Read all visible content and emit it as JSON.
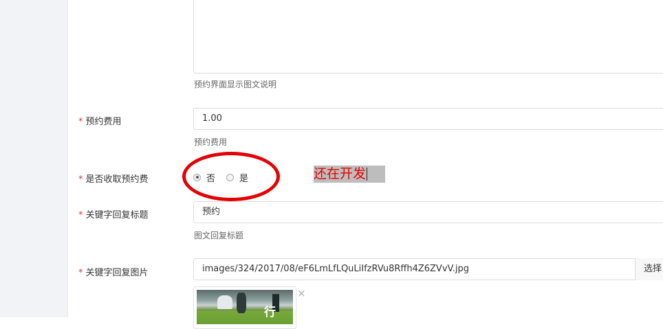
{
  "form": {
    "description_help": "预约界面显示图文说明",
    "fee": {
      "label": "预约费用",
      "value": "1.00",
      "help": "预约费用"
    },
    "charge_fee": {
      "label": "是否收取预约费",
      "options": [
        "否",
        "是"
      ],
      "selected": "否"
    },
    "keyword_title": {
      "label": "关键字回复标题",
      "value": "预约",
      "help": "图文回复标题"
    },
    "keyword_image": {
      "label": "关键字回复图片",
      "value": "images/324/2017/08/eF6LmLfLQuLiIfzRVu8Rffh4Z6ZVvV.jpg",
      "button": "选择",
      "thumb_text": "行",
      "remove_symbol": "×"
    },
    "required_mark": "*"
  },
  "annotation": {
    "note": "还在开发",
    "color": "#e60000"
  }
}
